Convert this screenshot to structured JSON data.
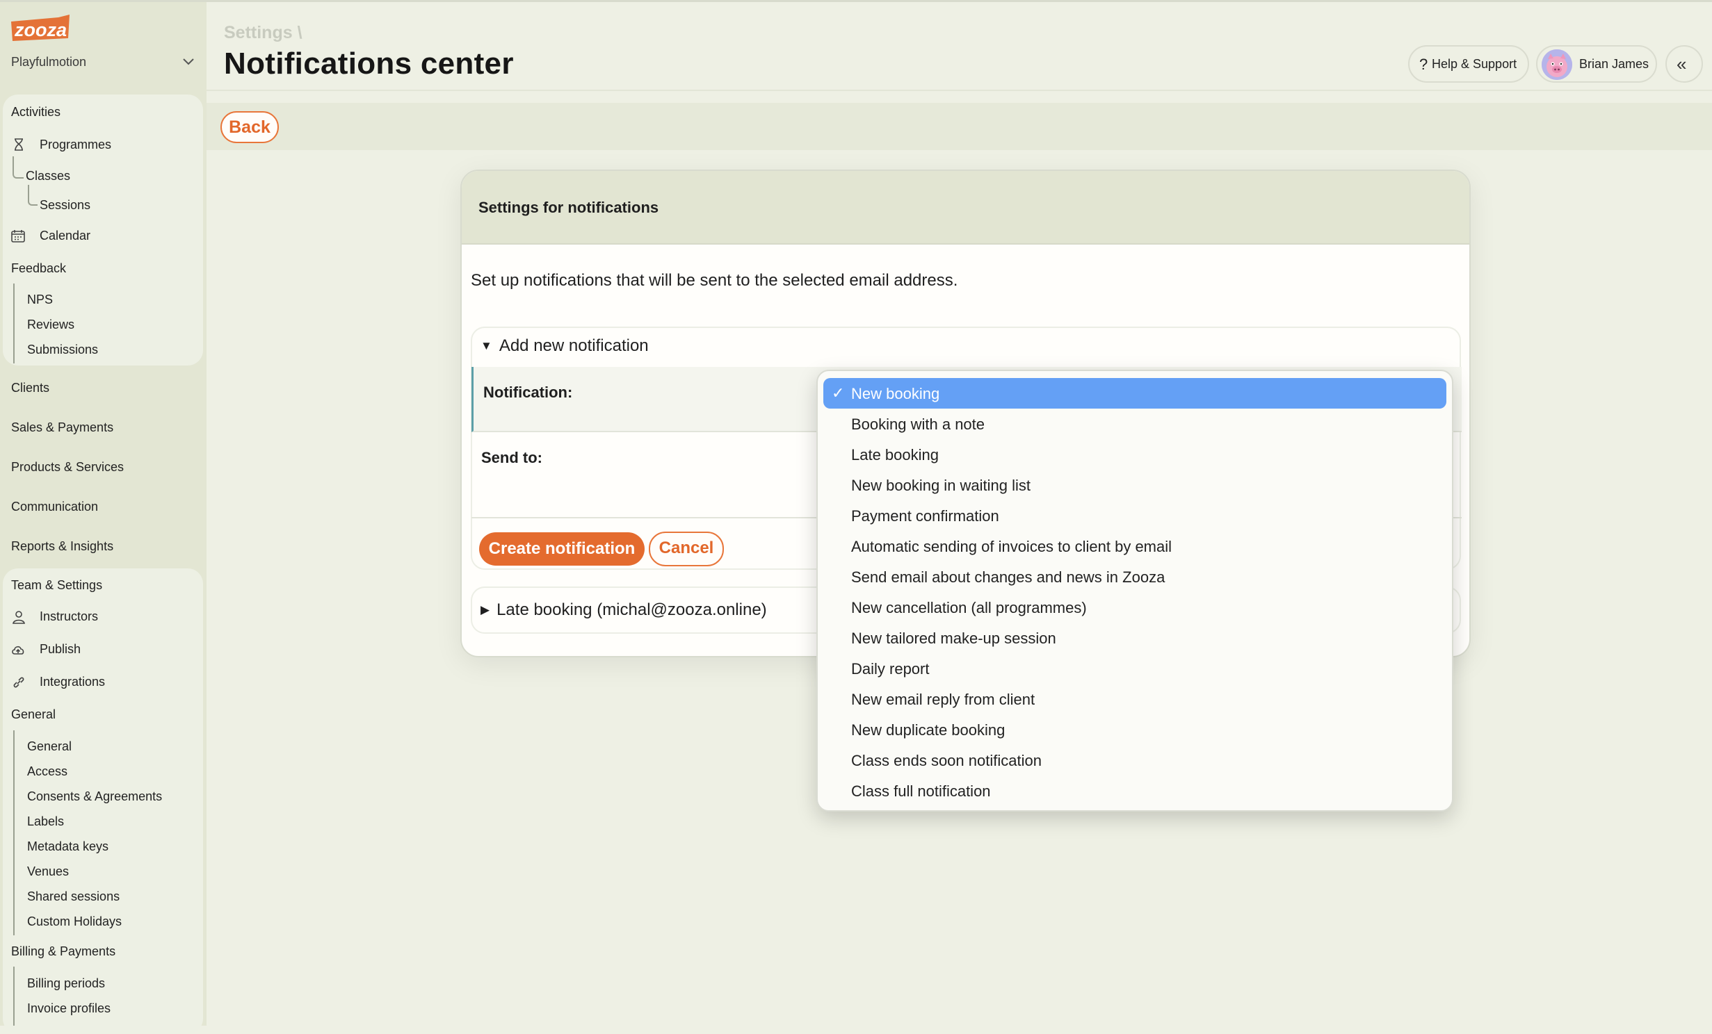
{
  "sidebar": {
    "org_name": "Playfulmotion",
    "activities": {
      "heading": "Activities",
      "programmes": "Programmes",
      "classes": "Classes",
      "sessions": "Sessions",
      "calendar": "Calendar"
    },
    "feedback": {
      "heading": "Feedback",
      "items": [
        "NPS",
        "Reviews",
        "Submissions"
      ]
    },
    "main_items": [
      "Clients",
      "Sales & Payments",
      "Products & Services",
      "Communication",
      "Reports & Insights"
    ],
    "team": {
      "heading": "Team & Settings",
      "instructors": "Instructors",
      "publish": "Publish",
      "integrations": "Integrations"
    },
    "general": {
      "heading": "General",
      "items": [
        "General",
        "Access",
        "Consents & Agreements",
        "Labels",
        "Metadata keys",
        "Venues",
        "Shared sessions",
        "Custom Holidays"
      ]
    },
    "billing": {
      "heading": "Billing & Payments",
      "items": [
        "Billing periods",
        "Invoice profiles"
      ]
    }
  },
  "header": {
    "breadcrumb": "Settings \\",
    "title": "Notifications center",
    "help_label": "Help & Support",
    "user_name": "Brian James"
  },
  "back_label": "Back",
  "modal": {
    "title": "Settings for notifications",
    "description": "Set up notifications that will be sent to the selected email address.",
    "add_section_title": "Add new notification",
    "notification_label": "Notification:",
    "send_to_label": "Send to:",
    "create_label": "Create notification",
    "cancel_label": "Cancel",
    "existing_notification": "Late booking (michal@zooza.online)"
  },
  "dropdown": {
    "selected": "New booking",
    "options": [
      "New booking",
      "Booking with a note",
      "Late booking",
      "New booking in waiting list",
      "Payment confirmation",
      "Automatic sending of invoices to client by email",
      "Send email about changes and news in Zooza",
      "New cancellation (all programmes)",
      "New tailored make-up session",
      "Daily report",
      "New email reply from client",
      "New duplicate booking",
      "Class ends soon notification",
      "Class full notification"
    ]
  },
  "colors": {
    "accent": "#e46b2e",
    "selected_option": "#64a0f5",
    "sidebar_bg": "#e3e6d3",
    "page_bg": "#eef0e4"
  }
}
